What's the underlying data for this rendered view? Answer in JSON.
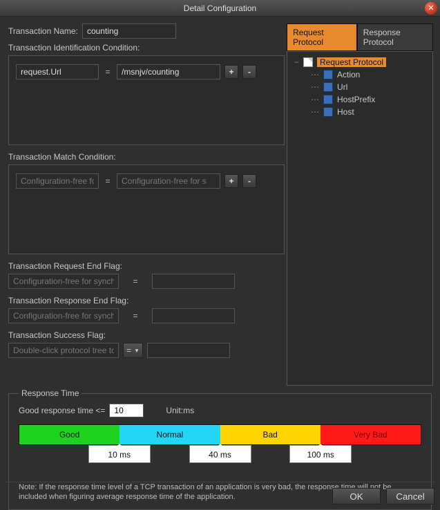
{
  "title": "Detail Configuration",
  "txnNameLabel": "Transaction Name:",
  "txnNameValue": "counting",
  "idCondLabel": "Transaction Identification Condition:",
  "idCond": {
    "field": "request.Url",
    "value": "/msnjv/counting"
  },
  "matchCondLabel": "Transaction Match Condition:",
  "matchCond": {
    "fieldPh": "Configuration-free for s",
    "valuePh": "Configuration-free for s"
  },
  "reqEndLabel": "Transaction Request End Flag:",
  "reqEnd": {
    "fieldPh": "Configuration-free for synchr"
  },
  "respEndLabel": "Transaction Response End Flag:",
  "respEnd": {
    "fieldPh": "Configuration-free for synchr"
  },
  "successLabel": "Transaction Success Flag:",
  "success": {
    "fieldPh": "Double-click protocol tree to a",
    "opValue": "="
  },
  "tabs": {
    "req": "Request Protocol",
    "resp": "Response Protocol"
  },
  "tree": {
    "root": "Request Protocol",
    "items": [
      "Action",
      "Url",
      "HostPrefix",
      "Host"
    ]
  },
  "rt": {
    "legend": "Response Time",
    "goodLabel": "Good response time <=",
    "goodValue": "10",
    "unit": "Unit:ms",
    "segs": {
      "good": "Good",
      "normal": "Normal",
      "bad": "Bad",
      "vbad": "Very Bad"
    },
    "markers": {
      "m1": "10 ms",
      "m2": "40 ms",
      "m3": "100 ms"
    },
    "note": "Note: If the response time level of a TCP transaction of an application is very bad, the response time will not be included when figuring average response time of the application."
  },
  "buttons": {
    "ok": "OK",
    "cancel": "Cancel",
    "plus": "+",
    "minus": "-"
  }
}
